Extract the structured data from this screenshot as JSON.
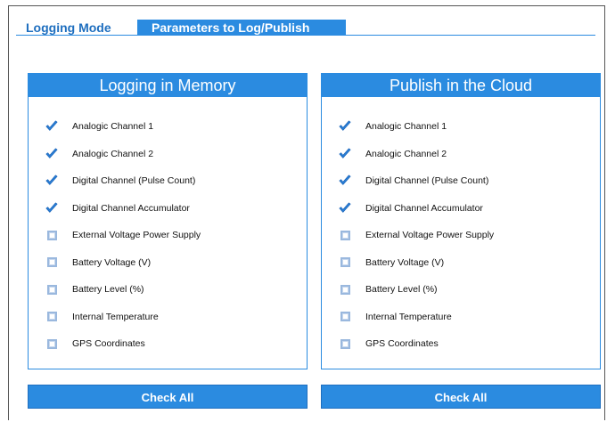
{
  "tabs": [
    {
      "label": "Logging Mode",
      "active": false
    },
    {
      "label": "Parameters to Log/Publish",
      "active": true
    }
  ],
  "colors": {
    "accent": "#2b8be0",
    "tab_text": "#1f6fbf"
  },
  "panels": [
    {
      "title": "Logging in Memory",
      "button": "Check All",
      "items": [
        {
          "label": "Analogic Channel 1",
          "checked": true
        },
        {
          "label": "Analogic Channel 2",
          "checked": true
        },
        {
          "label": "Digital Channel (Pulse Count)",
          "checked": true
        },
        {
          "label": "Digital Channel Accumulator",
          "checked": true
        },
        {
          "label": "External Voltage Power Supply",
          "checked": false
        },
        {
          "label": "Battery Voltage (V)",
          "checked": false
        },
        {
          "label": "Battery Level (%)",
          "checked": false
        },
        {
          "label": "Internal Temperature",
          "checked": false
        },
        {
          "label": "GPS Coordinates",
          "checked": false
        }
      ]
    },
    {
      "title": "Publish in the Cloud",
      "button": "Check All",
      "items": [
        {
          "label": "Analogic Channel 1",
          "checked": true
        },
        {
          "label": "Analogic Channel 2",
          "checked": true
        },
        {
          "label": "Digital Channel (Pulse Count)",
          "checked": true
        },
        {
          "label": "Digital Channel Accumulator",
          "checked": true
        },
        {
          "label": "External Voltage Power Supply",
          "checked": false
        },
        {
          "label": "Battery Voltage (V)",
          "checked": false
        },
        {
          "label": "Battery Level (%)",
          "checked": false
        },
        {
          "label": "Internal Temperature",
          "checked": false
        },
        {
          "label": "GPS Coordinates",
          "checked": false
        }
      ]
    }
  ]
}
